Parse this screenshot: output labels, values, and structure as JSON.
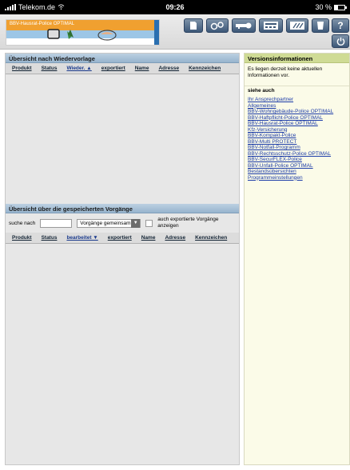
{
  "statusbar": {
    "carrier": "Telekom.de",
    "time": "09:26",
    "battery": "30 %"
  },
  "banner": {
    "title": "BBV-Hausrat-Police OPTIMAL"
  },
  "toolbar": {
    "icons": [
      "document-icon",
      "settings-icon",
      "key-icon",
      "calculator-icon",
      "edit-icon",
      "trash-icon",
      "help-icon",
      "power-icon"
    ]
  },
  "wiedervorlage": {
    "title": "Übersicht nach Wiedervorlage",
    "columns": [
      "Produkt",
      "Status",
      "Wieder. ▲",
      "exportiert",
      "Name",
      "Adresse",
      "Kennzeichen"
    ]
  },
  "vorgaenge": {
    "title": "Übersicht über die gespeicherten Vorgänge",
    "search_label": "suche nach",
    "search_value": "",
    "select_value": "Vorgänge gemeinsam",
    "checkbox_label": "auch exportierte Vorgänge anzeigen",
    "columns": [
      "Produkt",
      "Status",
      "bearbeitet ▼",
      "exportiert",
      "Name",
      "Adresse",
      "Kennzeichen"
    ]
  },
  "versions": {
    "title": "Versionsinformationen",
    "text": "Es liegen derzeit keine aktuellen Informationen vor.",
    "see_also": "siehe auch",
    "links": [
      "Ihr Ansprechpartner",
      "Allgemeines",
      "BBV-Wohngebäude-Police OPTIMAL",
      "BBV-Haftpflicht-Police OPTIMAL",
      "BBV-Hausrat-Police OPTIMAL",
      "Kfz-Versicherung",
      "BBV-Kompakt-Police",
      "BBV-Multi PROTECT",
      "BBV-Notfall-Programm",
      "BBV-Rechtsschutz-Police OPTIMAL",
      "BBV-SecurFLEX-Police",
      "BBV-Unfall-Police OPTIMAL",
      "Bestandsübersichten",
      "Programmeinstellungen"
    ]
  }
}
